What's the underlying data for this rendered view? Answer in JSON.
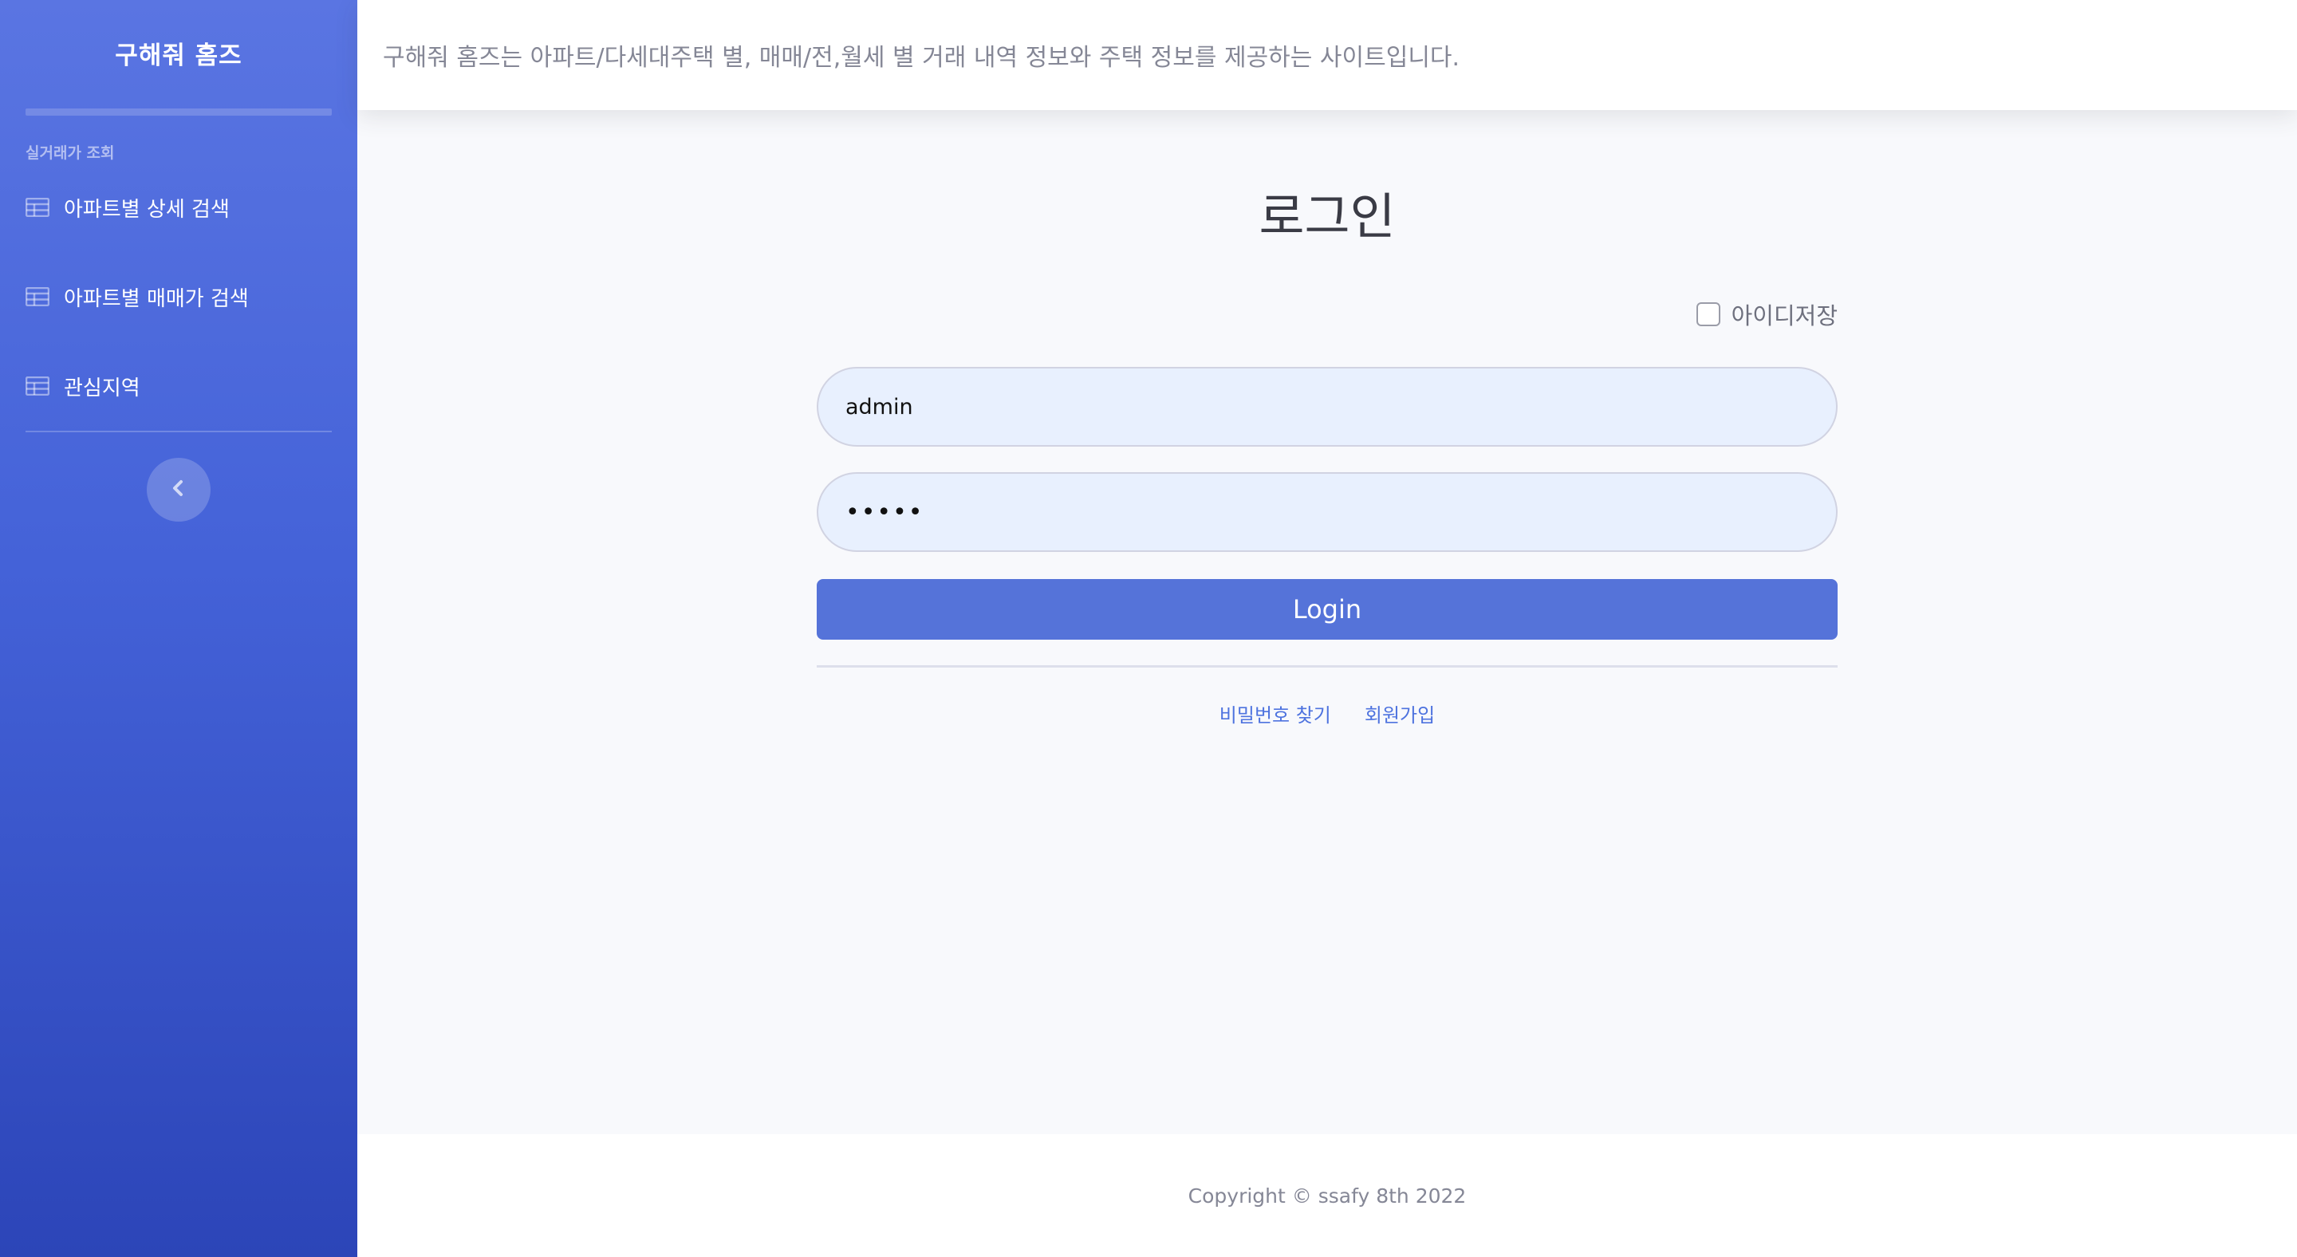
{
  "sidebar": {
    "brand": "구해줘 홈즈",
    "heading": "실거래가 조회",
    "items": [
      {
        "label": "아파트별 상세 검색",
        "icon": "table-icon"
      },
      {
        "label": "아파트별 매매가 검색",
        "icon": "table-icon"
      },
      {
        "label": "관심지역",
        "icon": "table-icon"
      }
    ],
    "toggle_icon": "chevron-left-icon"
  },
  "topbar": {
    "description": "구해줘 홈즈는 아파트/다세대주택 별, 매매/전,월세 별 거래 내역 정보와 주택 정보를 제공하는 사이트입니다."
  },
  "login": {
    "title": "로그인",
    "remember_label": "아이디저장",
    "remember_checked": false,
    "username_value": "admin",
    "password_value": "•••••",
    "submit_label": "Login",
    "find_password_link": "비밀번호 찾기",
    "signup_link": "회원가입"
  },
  "footer": {
    "copyright": "Copyright © ssafy 8th 2022"
  },
  "colors": {
    "sidebar_top": "#5a75e2",
    "sidebar_bottom": "#2c45b8",
    "primary_button": "#5573d9",
    "link": "#4e73df",
    "input_bg": "#e8f0fe"
  }
}
